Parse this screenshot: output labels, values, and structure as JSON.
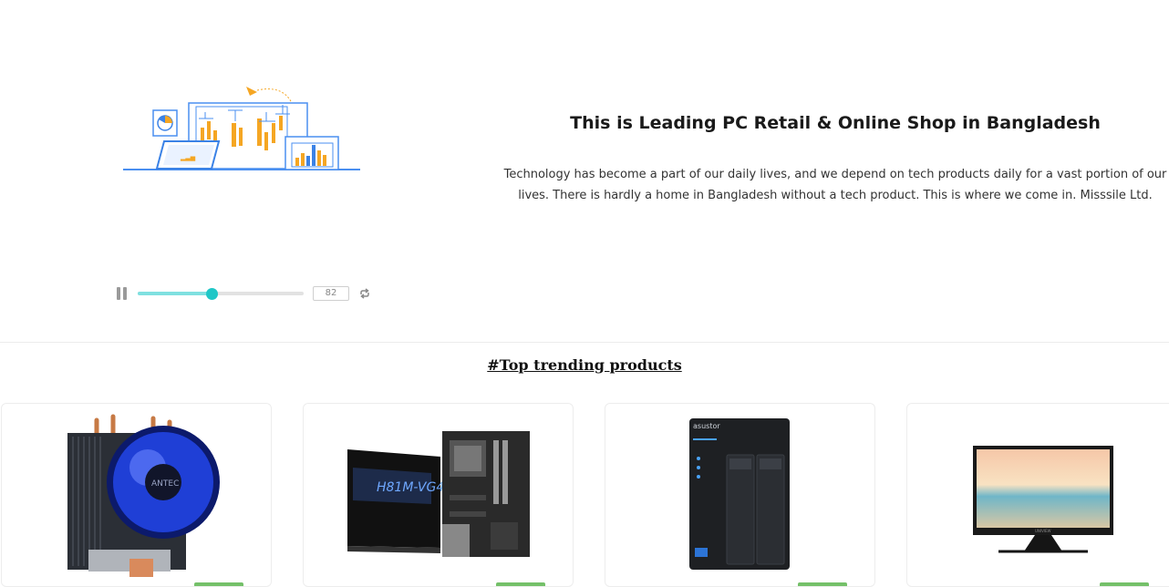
{
  "hero": {
    "title": "This is Leading PC Retail & Online Shop in Bangladesh",
    "description": "Technology has become a part of our daily lives, and we depend on tech products daily for a vast portion of our lives. There is hardly a home in Bangladesh without a tech product. This is where we come in. Misssile Ltd.",
    "animation": {
      "frame": "82",
      "progress": 0.45
    }
  },
  "trending": {
    "title": "#Top trending products"
  },
  "products": [
    {
      "image_icon": "cpu-cooler-icon"
    },
    {
      "image_icon": "motherboard-icon"
    },
    {
      "image_icon": "nas-device-icon"
    },
    {
      "image_icon": "monitor-icon"
    }
  ],
  "colors": {
    "accent": "#1fc7c7",
    "badge": "#74c069",
    "illustration_blue": "#3b82e6",
    "illustration_orange": "#f5a623"
  }
}
